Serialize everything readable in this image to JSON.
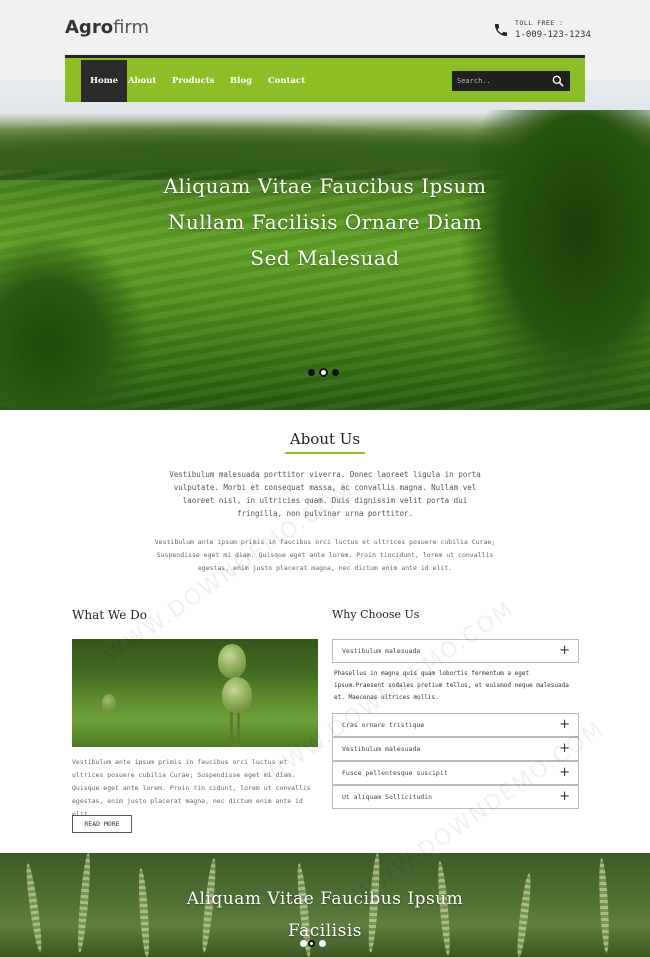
{
  "brand": {
    "bold": "Agro",
    "light": "firm"
  },
  "contact": {
    "label": "TOLL FREE :",
    "number": "1-009-123-1234"
  },
  "nav": {
    "items": [
      {
        "label": "Home",
        "active": true
      },
      {
        "label": "About",
        "active": false
      },
      {
        "label": "Products",
        "active": false
      },
      {
        "label": "Blog",
        "active": false
      },
      {
        "label": "Contact",
        "active": false
      }
    ],
    "search_placeholder": "Search.."
  },
  "hero": {
    "lines": [
      "Aliquam Vitae Faucibus Ipsum",
      "Nullam Facilisis Ornare Diam",
      "Sed Malesuad"
    ],
    "slide_count": 3,
    "active_slide": 2
  },
  "about": {
    "title": "About Us",
    "p1": "Vestibulum malesuada porttitor viverra. Donec laoreet ligula in porta vulputate. Morbi et consequat massa, ac convallis magna. Nullam vel laoreet nisl, in ultricies quam. Duis dignissim velit porta dui fringilla, non pulvinar urna porttitor.",
    "p2": "Vestibulum ante ipsum primis in faucibus orci luctus et ultrices posuere cubilia Curae; Suspendisse eget mi diam. Quisque eget ante lorem. Proin tincidunt, lorem ut convallis egestas, enim justo placerat magna, nec dictum enim ante id elit."
  },
  "what": {
    "title": "What We Do",
    "text": "Vestibulum ante ipsum primis in faucibus orci luctus et ultrices posuere cubilia Curae; Suspendisse eget mi diam. Quisque eget ante lorem. Proin tin cidunt, lorem ut convallis egestas, enim justo placerat magna, nec dictum enim ante id elit.",
    "button": "READ MORE"
  },
  "why": {
    "title": "Why Choose Us",
    "open_item": "Vestibulum malesuada",
    "open_body": "Phasellus in magna quis quam lobortis fermentum a eget ipsum.Praesent sodales pretium tellus, et euismod neque malesuada et. Maecenas ultrices mollis.",
    "items": [
      "Cras ornare tristique",
      "Vestibulum malesuada",
      "Fusce pellentesque suscipit",
      "Ut aliquam Sollicitudin"
    ],
    "toggle_symbol": "+"
  },
  "banner": {
    "lines": [
      "Aliquam Vitae Faucibus Ipsum",
      "Facilisis"
    ],
    "slide_count": 3,
    "active_slide": 2
  },
  "watermark": "WWW.DOWNDEMO.COM",
  "colors": {
    "accent": "#8cbf26",
    "dark": "#2b2b2b"
  }
}
